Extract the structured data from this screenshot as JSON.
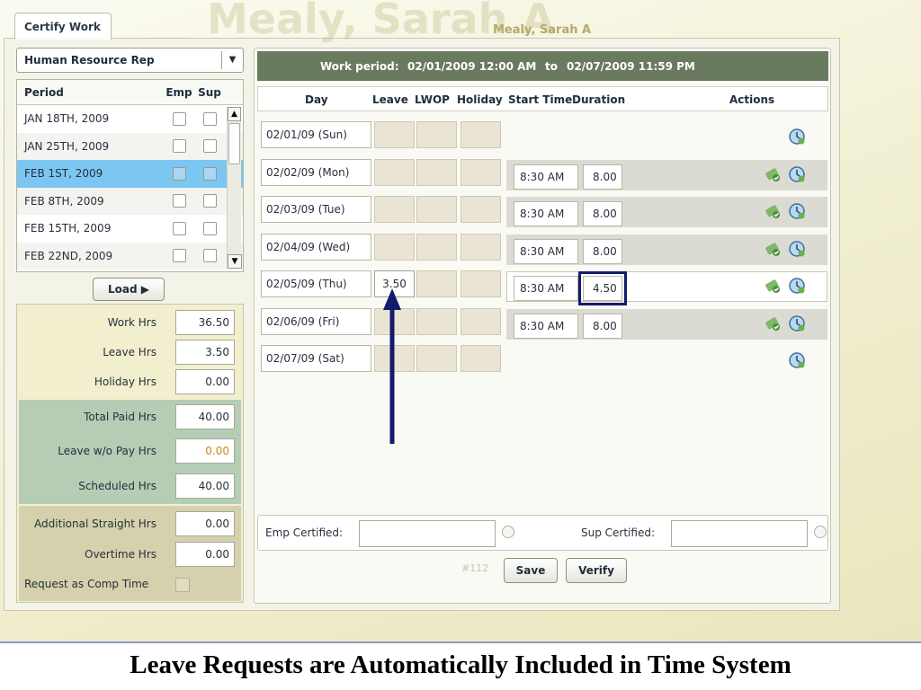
{
  "watermark": "Mealy, Sarah A",
  "user_name": "Mealy, Sarah A",
  "tab_label": "Certify Work",
  "department": "Human Resource Rep",
  "period_table": {
    "headers": {
      "period": "Period",
      "emp": "Emp",
      "sup": "Sup"
    },
    "rows": [
      {
        "period": "JAN 18TH, 2009",
        "selected": false
      },
      {
        "period": "JAN 25TH, 2009",
        "selected": false
      },
      {
        "period": "FEB 1ST, 2009",
        "selected": true
      },
      {
        "period": "FEB 8TH, 2009",
        "selected": false
      },
      {
        "period": "FEB 15TH, 2009",
        "selected": false
      },
      {
        "period": "FEB 22ND, 2009",
        "selected": false
      }
    ]
  },
  "load_label": "Load",
  "totals": {
    "work_hrs_label": "Work Hrs",
    "work_hrs": "36.50",
    "leave_hrs_label": "Leave Hrs",
    "leave_hrs": "3.50",
    "holiday_hrs_label": "Holiday Hrs",
    "holiday_hrs": "0.00",
    "total_paid_label": "Total Paid Hrs",
    "total_paid": "40.00",
    "leave_wo_pay_label": "Leave w/o Pay Hrs",
    "leave_wo_pay": "0.00",
    "scheduled_label": "Scheduled Hrs",
    "scheduled": "40.00",
    "additional_label": "Additional Straight Hrs",
    "additional": "0.00",
    "overtime_label": "Overtime Hrs",
    "overtime": "0.00",
    "comp_time_label": "Request as Comp Time"
  },
  "work_period": {
    "label": "Work period:",
    "start": "02/01/2009 12:00 AM",
    "to": "to",
    "end": "02/07/2009 11:59 PM"
  },
  "columns": {
    "day": "Day",
    "leave": "Leave",
    "lwop": "LWOP",
    "holiday": "Holiday",
    "start_time": "Start Time",
    "duration": "Duration",
    "actions": "Actions"
  },
  "days": [
    {
      "day": "02/01/09 (Sun)",
      "leave": "",
      "start": "",
      "duration": ""
    },
    {
      "day": "02/02/09 (Mon)",
      "leave": "",
      "start": "8:30 AM",
      "duration": "8.00"
    },
    {
      "day": "02/03/09 (Tue)",
      "leave": "",
      "start": "8:30 AM",
      "duration": "8.00"
    },
    {
      "day": "02/04/09 (Wed)",
      "leave": "",
      "start": "8:30 AM",
      "duration": "8.00"
    },
    {
      "day": "02/05/09 (Thu)",
      "leave": "3.50",
      "start": "8:30 AM",
      "duration": "4.50"
    },
    {
      "day": "02/06/09 (Fri)",
      "leave": "",
      "start": "8:30 AM",
      "duration": "8.00"
    },
    {
      "day": "02/07/09 (Sat)",
      "leave": "",
      "start": "",
      "duration": ""
    }
  ],
  "emp_certified_label": "Emp Certified:",
  "sup_certified_label": "Sup Certified:",
  "ticket": "#112",
  "save_label": "Save",
  "verify_label": "Verify",
  "caption": "Leave Requests are Automatically Included in Time System",
  "colors": {
    "selected_row": "#7cc6f2",
    "header_bar": "#6a7a5e",
    "highlight": "#141a6e"
  }
}
